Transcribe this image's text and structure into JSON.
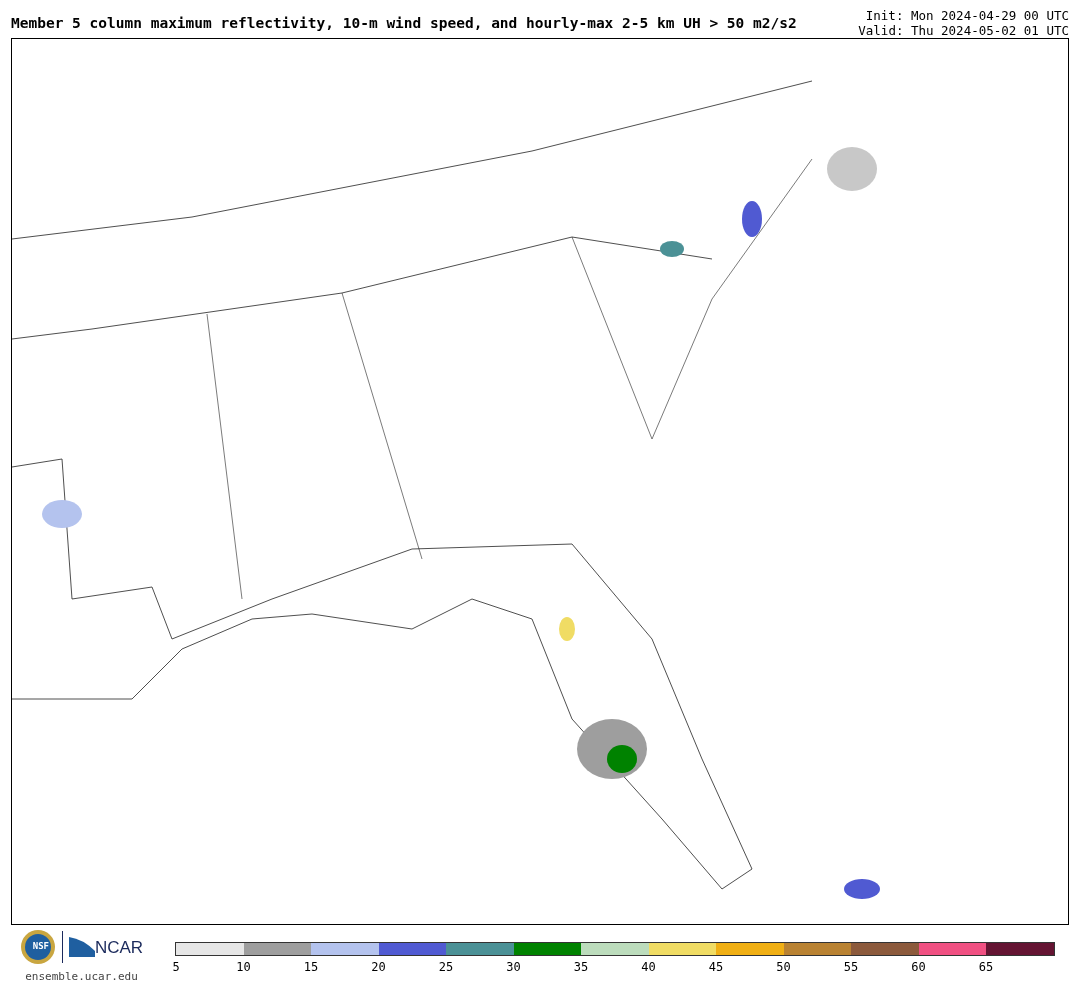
{
  "title": "Member 5 column maximum reflectivity, 10-m wind speed, and hourly-max 2-5 km UH > 50 m2/s2",
  "init": "Init: Mon 2024-04-29 00 UTC",
  "valid": "Valid: Thu 2024-05-02 01 UTC",
  "logos": {
    "nsf": "NSF",
    "ncar": "NCAR",
    "url": "ensemble.ucar.edu"
  },
  "colorbar": [
    {
      "label": "5",
      "color": "#e6e6e6"
    },
    {
      "label": "10",
      "color": "#9e9e9e"
    },
    {
      "label": "15",
      "color": "#b4c3ee"
    },
    {
      "label": "20",
      "color": "#505ad2"
    },
    {
      "label": "25",
      "color": "#4b9196"
    },
    {
      "label": "30",
      "color": "#008200"
    },
    {
      "label": "35",
      "color": "#bcdcbc"
    },
    {
      "label": "40",
      "color": "#f0dc64"
    },
    {
      "label": "45",
      "color": "#f0af14"
    },
    {
      "label": "50",
      "color": "#b98232"
    },
    {
      "label": "55",
      "color": "#8c5a3c"
    },
    {
      "label": "60",
      "color": "#f05082"
    },
    {
      "label": "65",
      "color": "#641432"
    }
  ]
}
